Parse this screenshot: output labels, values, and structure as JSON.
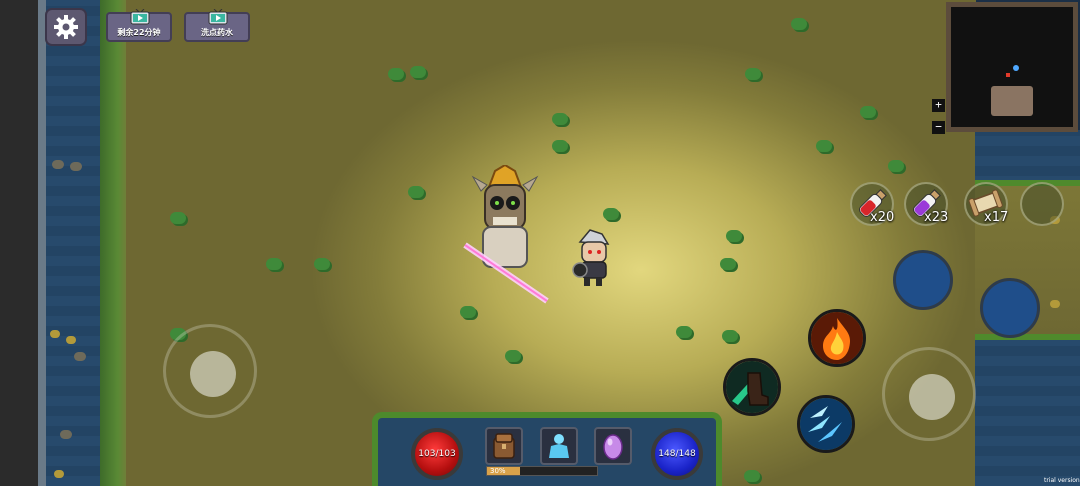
{
  "hud": {
    "settings_icon": "gear-icon",
    "ad_buttons": [
      {
        "label": "剩余22分钟",
        "icon": "tv-icon"
      },
      {
        "label": "洗点药水",
        "icon": "tv-icon"
      }
    ]
  },
  "minimap": {
    "zoom_in": "+",
    "zoom_out": "−"
  },
  "consumables": [
    {
      "name": "health-potion",
      "count": "x20",
      "color": "#d8262b"
    },
    {
      "name": "mana-potion",
      "count": "x23",
      "color": "#9a3ad8"
    },
    {
      "name": "scroll",
      "count": "x17",
      "color": "#d6c39a"
    }
  ],
  "bottom_bar": {
    "hp": "103/103",
    "mp": "148/148",
    "xp": {
      "label": "30%",
      "fraction": 0.3
    },
    "slots": [
      "inventory-bag-icon",
      "character-icon",
      "pet-egg-icon"
    ]
  },
  "skills": [
    "fire-skill-icon",
    "dash-boot-skill-icon",
    "ice-shard-skill-icon"
  ],
  "watermark": "trial version",
  "colors": {
    "hp": "#d11a1a",
    "mp": "#1f2ad8",
    "skill_empty": "#1f4e8a"
  }
}
